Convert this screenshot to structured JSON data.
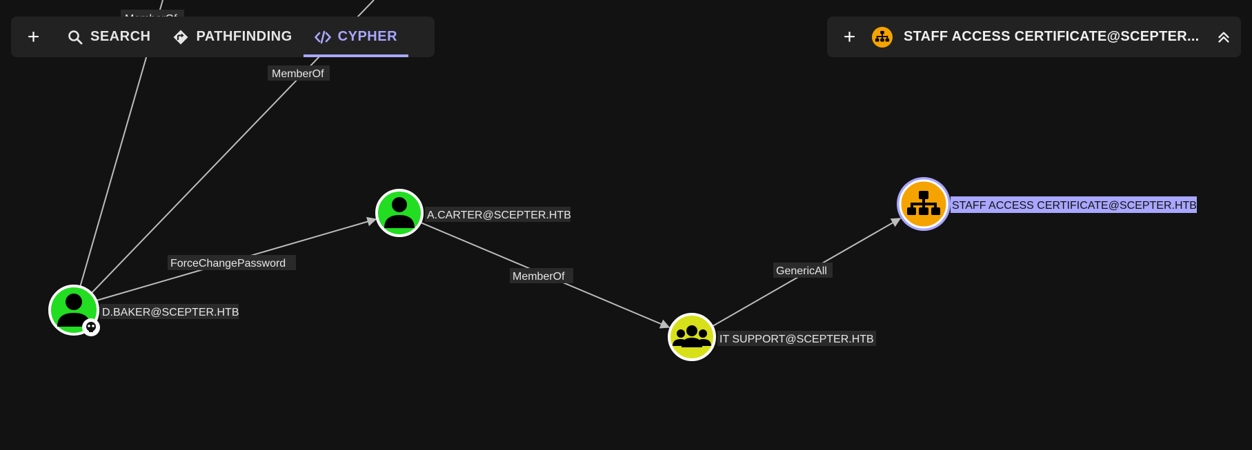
{
  "toolbar": {
    "plus": "+",
    "tabs": [
      {
        "label": "SEARCH",
        "icon": "search-icon"
      },
      {
        "label": "PATHFINDING",
        "icon": "directions-icon"
      },
      {
        "label": "CYPHER",
        "icon": "code-icon",
        "active": true
      }
    ]
  },
  "detail": {
    "plus": "+",
    "icon": "ou-icon",
    "title": "STAFF ACCESS CERTIFICATE@SCEPTER...",
    "collapse_icon": "double-chevron-up-icon"
  },
  "graph": {
    "nodes": {
      "dbaker": {
        "label": "D.BAKER@SCEPTER.HTB",
        "type": "user",
        "color": "#22dd22",
        "owned": true
      },
      "acarter": {
        "label": "A.CARTER@SCEPTER.HTB",
        "type": "user",
        "color": "#22dd22"
      },
      "itsupport": {
        "label": "IT SUPPORT@SCEPTER.HTB",
        "type": "group",
        "color": "#d8e01a"
      },
      "staffcert": {
        "label": "STAFF ACCESS CERTIFICATE@SCEPTER.HTB",
        "type": "ou",
        "color": "#f5a300",
        "selected": true
      }
    },
    "edges": {
      "e1": {
        "label": "ForceChangePassword"
      },
      "e2": {
        "label": "MemberOf"
      },
      "e3": {
        "label": "GenericAll"
      },
      "e4": {
        "label": "MemberOf"
      },
      "e5": {
        "label": "MemberOf"
      }
    },
    "colors": {
      "selection": "#a9a7ff",
      "edge": "#bdbdbd",
      "background": "#121212"
    }
  }
}
